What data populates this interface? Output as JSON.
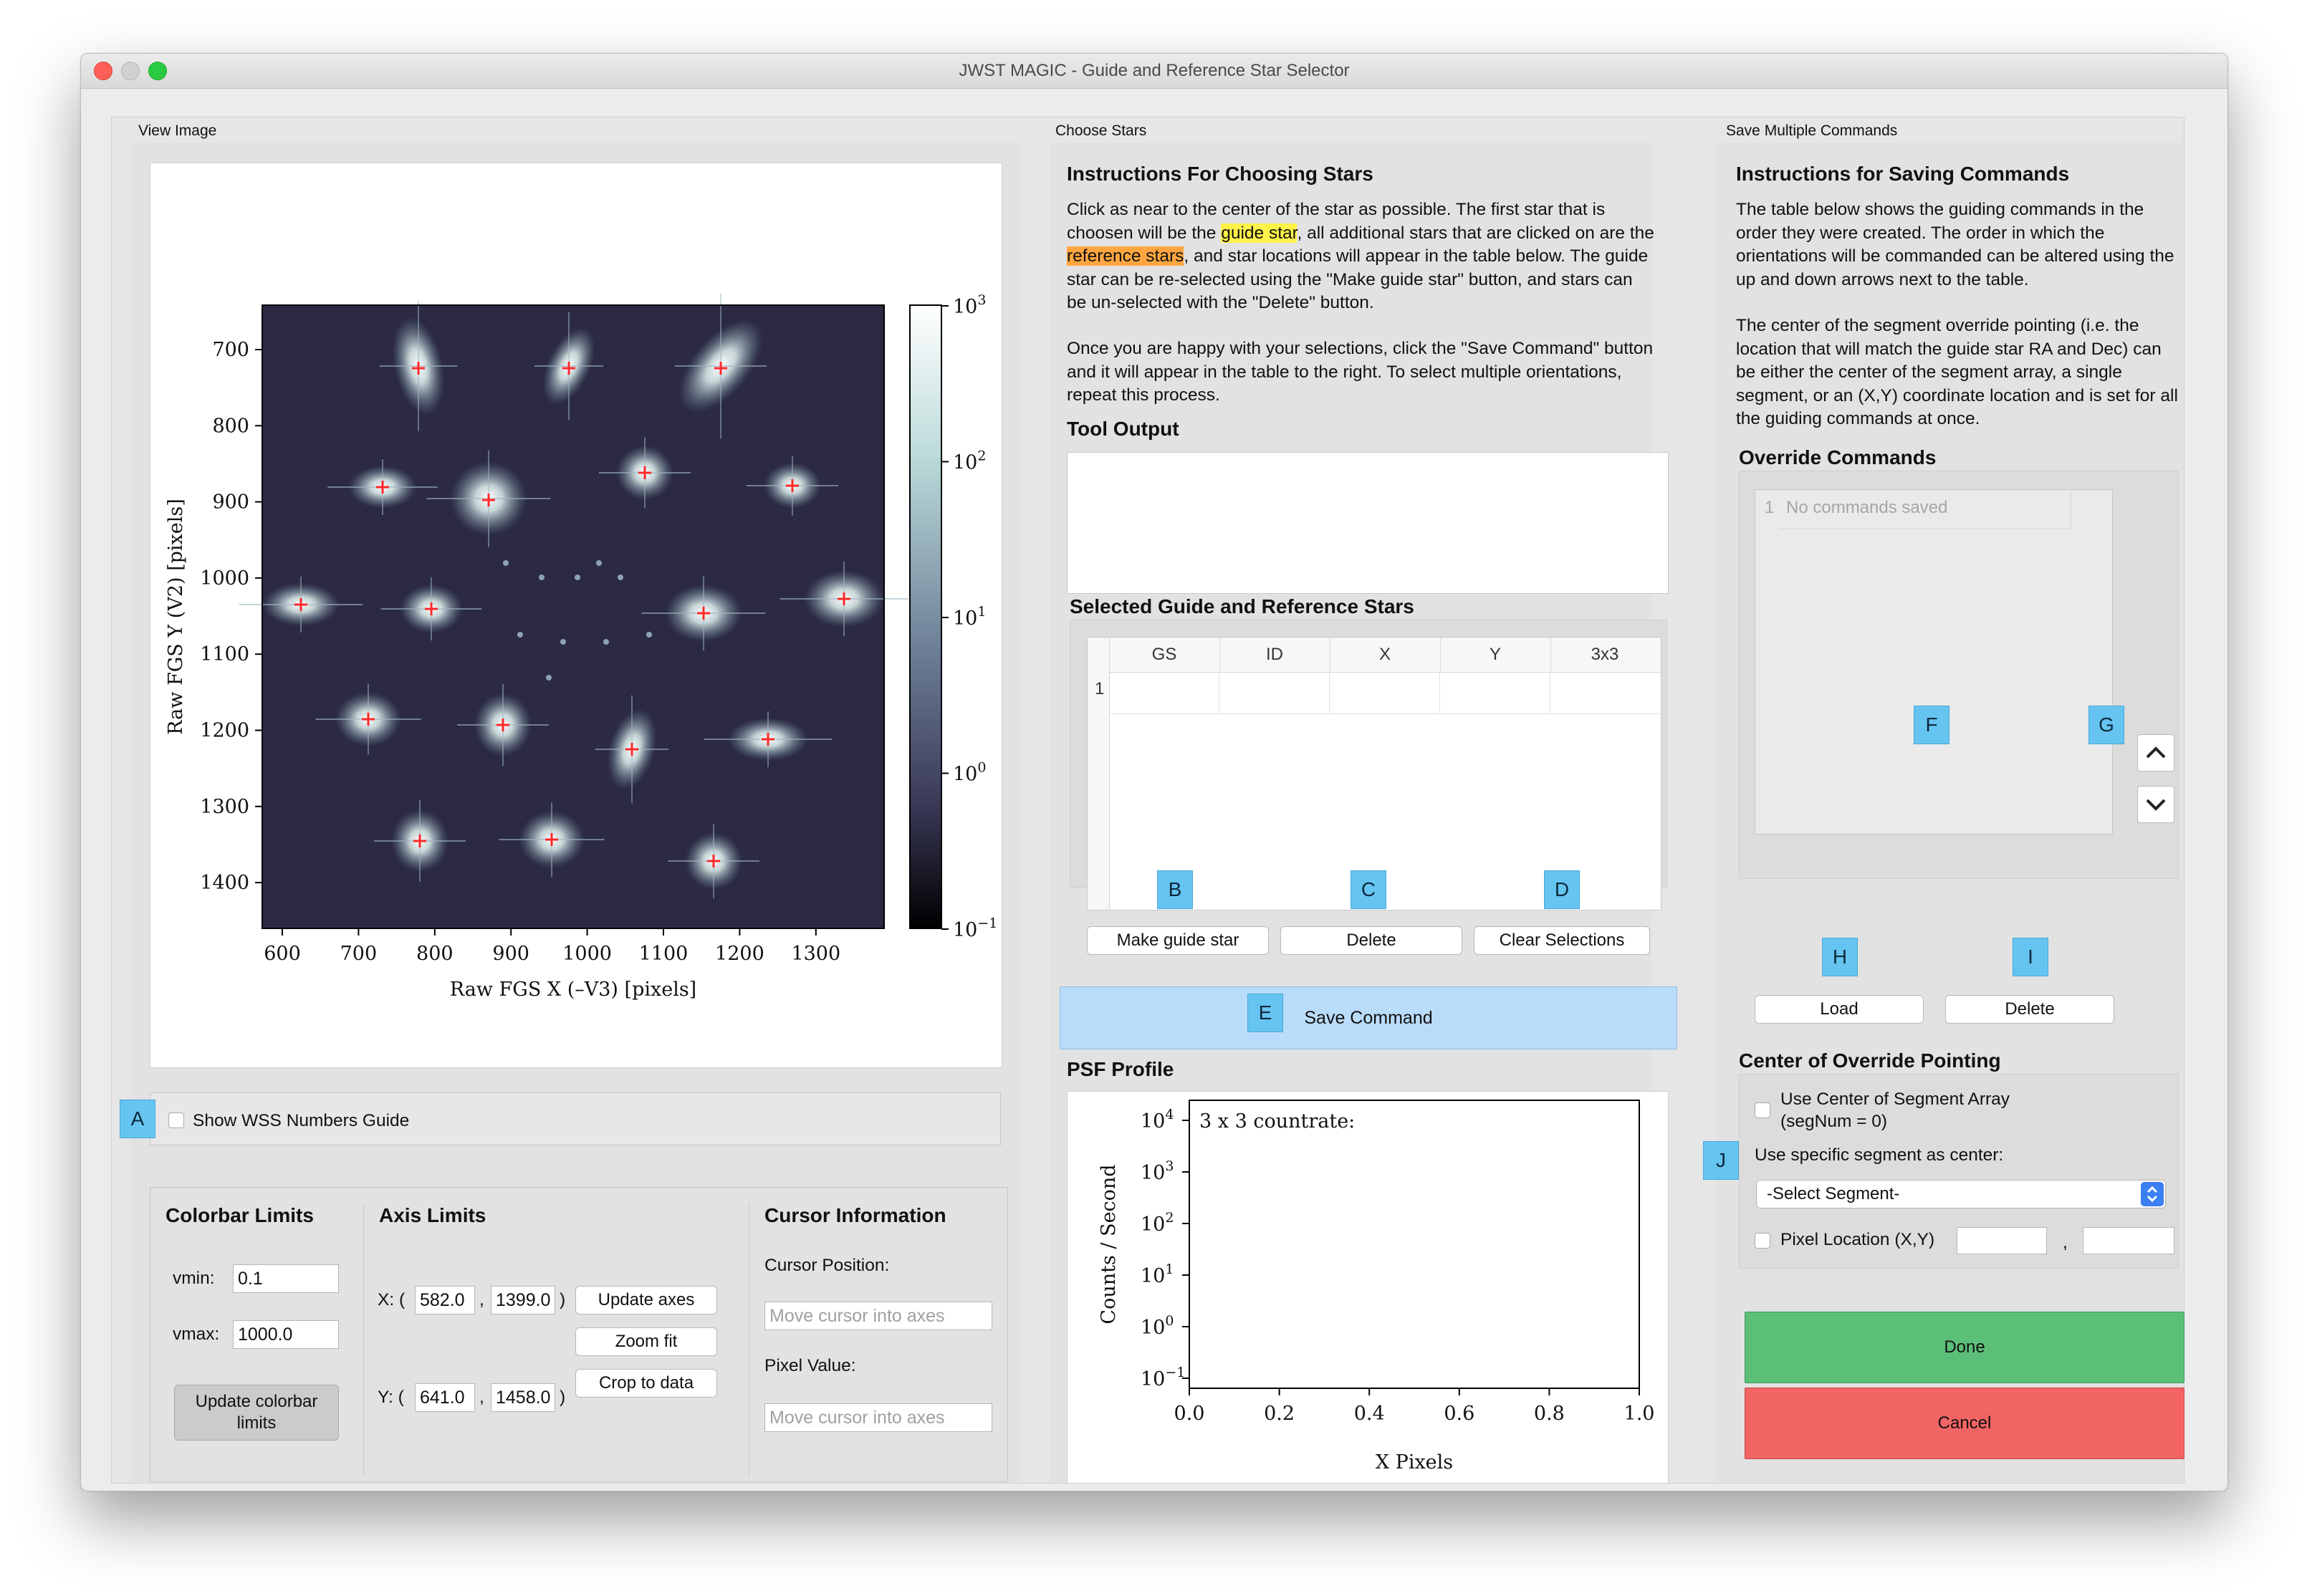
{
  "window": {
    "title": "JWST MAGIC - Guide and Reference Star Selector"
  },
  "view_image": {
    "group_title": "View Image",
    "plot": {
      "xlabel": "Raw FGS X (–V3) [pixels]",
      "ylabel": "Raw FGS Y (V2) [pixels]",
      "x_ticks": [
        "600",
        "700",
        "800",
        "900",
        "1000",
        "1100",
        "1200",
        "1300"
      ],
      "y_ticks": [
        "700",
        "800",
        "900",
        "1000",
        "1100",
        "1200",
        "1300",
        "1400"
      ],
      "colorbar_ticks": [
        {
          "base": "10",
          "exp": "3"
        },
        {
          "base": "10",
          "exp": "2"
        },
        {
          "base": "10",
          "exp": "1"
        },
        {
          "base": "10",
          "exp": "0"
        },
        {
          "base": "10",
          "exp": "−1"
        }
      ]
    },
    "wss_checkbox_label": "Show WSS Numbers Guide"
  },
  "colorbar_limits": {
    "title": "Colorbar Limits",
    "vmin_label": "vmin:",
    "vmin_value": "0.1",
    "vmax_label": "vmax:",
    "vmax_value": "1000.0",
    "update_button": "Update colorbar limits"
  },
  "axis_limits": {
    "title": "Axis Limits",
    "x_label": "X: (",
    "x_min": "582.0",
    "x_max": "1399.0",
    "y_label": "Y: (",
    "y_min": "641.0",
    "y_max": "1458.0",
    "comma": ",",
    "close": ")",
    "update_axes_button": "Update axes",
    "zoom_fit_button": "Zoom fit",
    "crop_button": "Crop to data"
  },
  "cursor_info": {
    "title": "Cursor Information",
    "position_label": "Cursor Position:",
    "position_placeholder": "Move cursor into axes",
    "value_label": "Pixel Value:",
    "value_placeholder": "Move cursor into axes"
  },
  "choose_stars": {
    "group_title": "Choose Stars",
    "instructions_title": "Instructions For Choosing Stars",
    "para1": {
      "before_guide": "Click as near to the center of the star as possible. The first star that is choosen will be the ",
      "guide_highlight": "guide star",
      "between": ", all additional stars that are clicked on are the ",
      "reference_highlight": "reference stars",
      "after": ", and star locations will appear in the table below. The guide star can be re-selected using the \"Make guide star\" button, and stars can be un-selected with the \"Delete\" button."
    },
    "para2": "Once you are happy with your selections, click the \"Save Command\" button and it will appear in the table to the right. To select multiple orientations, repeat this process.",
    "tool_output_title": "Tool Output",
    "selected_title": "Selected Guide and Reference Stars",
    "table_headers": [
      "GS",
      "ID",
      "X",
      "Y",
      "3x3"
    ],
    "row_numbers": [
      "1"
    ],
    "make_guide_button": "Make guide star",
    "delete_button": "Delete",
    "clear_button": "Clear Selections",
    "save_command_button": "Save Command"
  },
  "psf_profile": {
    "title": "PSF Profile",
    "annotation": "3 x 3 countrate:",
    "xlabel": "X Pixels",
    "ylabel": "Counts / Second",
    "x_ticks": [
      "0.0",
      "0.2",
      "0.4",
      "0.6",
      "0.8",
      "1.0"
    ],
    "y_ticks": [
      {
        "base": "10",
        "exp": "4"
      },
      {
        "base": "10",
        "exp": "3"
      },
      {
        "base": "10",
        "exp": "2"
      },
      {
        "base": "10",
        "exp": "1"
      },
      {
        "base": "10",
        "exp": "0"
      },
      {
        "base": "10",
        "exp": "−1"
      }
    ]
  },
  "save_commands": {
    "group_title": "Save Multiple Commands",
    "instructions_title": "Instructions for Saving Commands",
    "para1": "The table below shows the guiding commands in the order they were created. The order in which the orientations will be commanded can be altered using the up and down arrows next to the table.",
    "para2": "The center of the segment override pointing (i.e. the location that will match the guide star RA and Dec) can be either the center of the segment array, a single segment, or an (X,Y) coordinate location and is set for all the guiding commands at once.",
    "override_title": "Override Commands",
    "list_row_number": "1",
    "list_placeholder": "No commands saved",
    "load_button": "Load",
    "delete_button": "Delete",
    "center_title": "Center of Override Pointing",
    "use_center_label": "Use Center of Segment Array (segNum = 0)",
    "use_specific_label": "Use specific segment as center:",
    "segment_select": "-Select Segment-",
    "pixel_location_label": "Pixel Location (X,Y)",
    "pixel_comma": ",",
    "done_button": "Done",
    "cancel_button": "Cancel"
  },
  "markers": [
    "A",
    "B",
    "C",
    "D",
    "E",
    "F",
    "G",
    "H",
    "I",
    "J"
  ],
  "colors": {
    "done": "#5cbf78",
    "cancel": "#f36464",
    "save_command": "#b9dcfb",
    "marker": "#66c4f1",
    "guide_highlight": "#fff34a",
    "reference_highlight": "#ffa640",
    "star_marker": "#ff2a2a"
  }
}
